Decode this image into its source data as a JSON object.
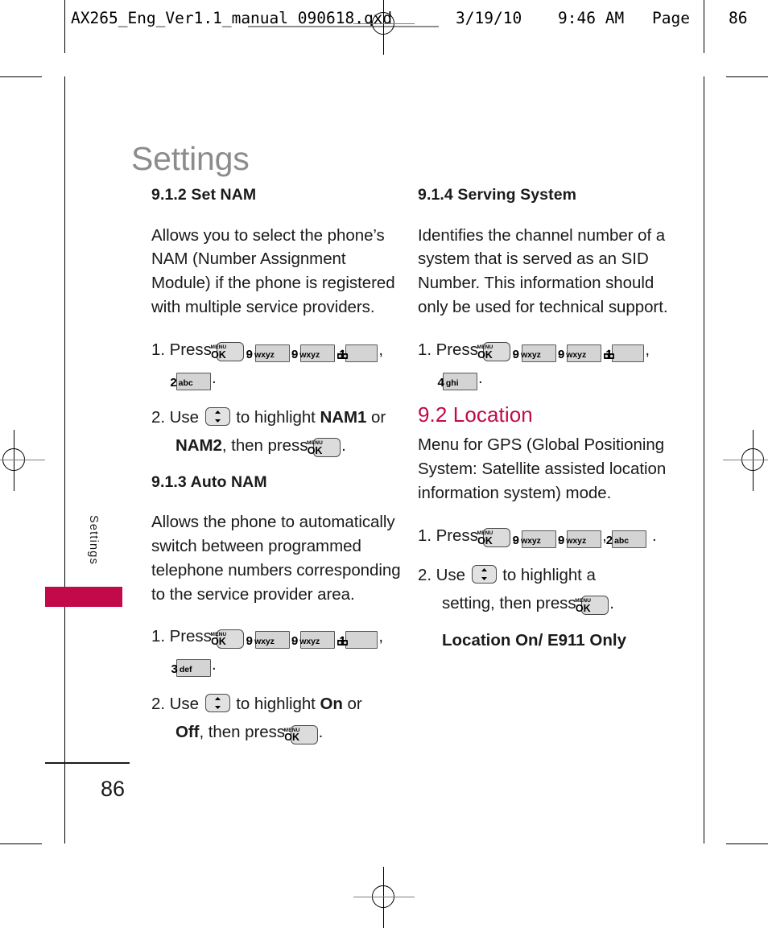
{
  "proof_header": {
    "file": "AX265_Eng_Ver1.1_manual_090618.qxd",
    "date": "3/19/10",
    "time": "9:46 AM",
    "page_label": "Page",
    "page_number": "86"
  },
  "page": {
    "title": "Settings",
    "side_tab_label": "Settings",
    "footer_page_number": "86"
  },
  "colors": {
    "accent": "#C20A4A",
    "title_gray": "#8C8C8C",
    "body_text": "#1A1A1A",
    "key_fill": "#D4D4D4",
    "key_border": "#585858"
  },
  "keys": {
    "menu_ok": {
      "top": "MENU",
      "bottom": "OK"
    },
    "nav_updown": "up-down navigation key",
    "k1": {
      "digit": "1",
      "letters": ""
    },
    "k2": {
      "digit": "2",
      "letters": "abc"
    },
    "k3": {
      "digit": "3",
      "letters": "def"
    },
    "k4": {
      "digit": "4",
      "letters": "ghi"
    },
    "k9": {
      "digit": "9",
      "letters": "wxyz"
    }
  },
  "left_column": {
    "sections": [
      {
        "heading": "9.1.2 Set NAM",
        "body": "Allows you to select the phone’s NAM (Number Assignment Module) if the phone is registered with multiple service providers.",
        "step1_prefix": "1. Press",
        "step1_comma": ",",
        "step1_period": ".",
        "step2_prefix": "2. Use",
        "step2_mid": "to highlight",
        "step2_opt_a": "NAM1",
        "step2_or": "or",
        "step2_opt_b": "NAM2",
        "step2_tail": ", then press",
        "step2_period": "."
      },
      {
        "heading": "9.1.3 Auto NAM",
        "body": "Allows the phone to automatically switch between programmed telephone numbers corresponding to the service provider area.",
        "step1_prefix": "1. Press",
        "step1_comma": ",",
        "step1_period": ".",
        "step2_prefix": "2. Use",
        "step2_mid": "to highlight",
        "step2_opt_a": "On",
        "step2_or": "or",
        "step2_opt_b": "Off",
        "step2_tail": ", then press",
        "step2_period": "."
      }
    ]
  },
  "right_column": {
    "sections": [
      {
        "heading": "9.1.4 Serving System",
        "body": "Identifies the channel number of a system that is served as an SID Number. This information should only be used for technical support.",
        "step1_prefix": "1. Press",
        "step1_comma": ",",
        "step1_period": "."
      },
      {
        "heading": "9.2 Location",
        "body": "Menu for GPS (Global Positioning System: Satellite assisted location information system) mode.",
        "step1_prefix": "1. Press",
        "step1_comma": ",",
        "step1_period": ".",
        "step2_prefix": "2. Use",
        "step2_mid": "to highlight a",
        "step2_cont": "setting, then press",
        "step2_period": ".",
        "options": "Location On/ E911  Only"
      }
    ]
  }
}
